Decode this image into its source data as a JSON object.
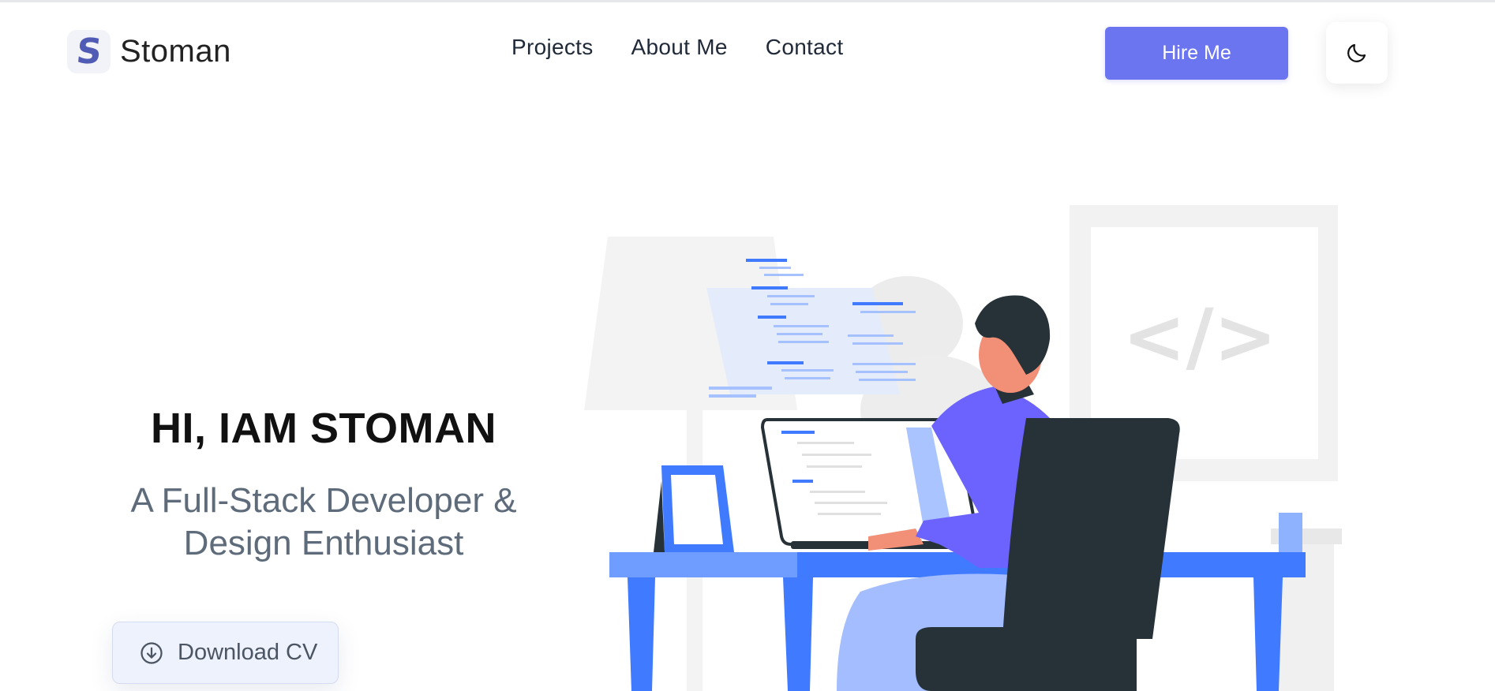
{
  "brand": {
    "logo_letter": "S",
    "name": "Stoman"
  },
  "nav": {
    "items": [
      "Projects",
      "About Me",
      "Contact"
    ]
  },
  "header": {
    "hire_label": "Hire Me",
    "theme_icon": "moon-icon"
  },
  "hero": {
    "title": "HI, IAM STOMAN",
    "subtitle_line1": "A Full-Stack Developer &",
    "subtitle_line2": "Design Enthusiast",
    "download_label": "Download CV",
    "download_icon": "download-circle-icon"
  },
  "illustration": {
    "code_sign": "</>"
  },
  "colors": {
    "accent": "#6c75f0",
    "illustration_blue": "#407bff",
    "person_shirt": "#6c63ff",
    "chair": "#263238"
  }
}
